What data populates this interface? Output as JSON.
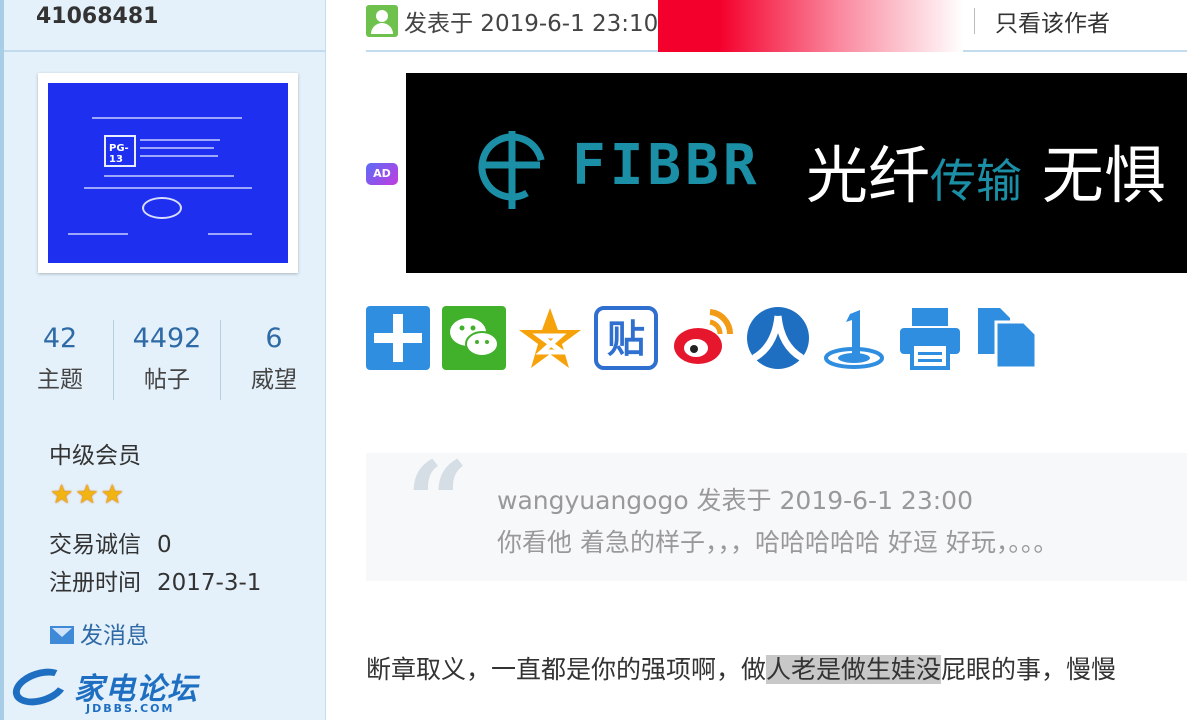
{
  "sidebar": {
    "user_id": "41068481",
    "stats": [
      {
        "value": "42",
        "label": "主题"
      },
      {
        "value": "4492",
        "label": "帖子"
      },
      {
        "value": "6",
        "label": "威望"
      }
    ],
    "level": "中级会员",
    "stars": 3,
    "trade_label": "交易诚信",
    "trade_value": "0",
    "reg_label": "注册时间",
    "reg_value": "2017-3-1",
    "message_label": "发消息",
    "avatar_rating": "PG-13",
    "forum_logo": "家电论坛",
    "forum_domain": "JDBBS.COM"
  },
  "post": {
    "posted_at": "发表于 2019-6-1 23:10",
    "only_author": "只看该作者",
    "ad_badge": "AD",
    "ad_brand": "FIBBR",
    "ad_slogan_a": "光纤",
    "ad_slogan_b": "传输",
    "ad_slogan_c": "无惧",
    "share_icons": [
      "add-share-icon",
      "wechat-icon",
      "qzone-icon",
      "tieba-icon",
      "weibo-icon",
      "renren-icon",
      "qqweibo-icon",
      "print-icon",
      "copy-icon"
    ],
    "quote_author": "wangyuangogo 发表于 2019-6-1 23:00",
    "quote_text": "你看他 着急的样子，，，哈哈哈哈哈 好逗  好玩，。。。",
    "reply_a": "断章取义，一直都是你的强项啊，做",
    "reply_hl": "人老是做生娃没",
    "reply_b": "屁眼的事，慢慢"
  }
}
